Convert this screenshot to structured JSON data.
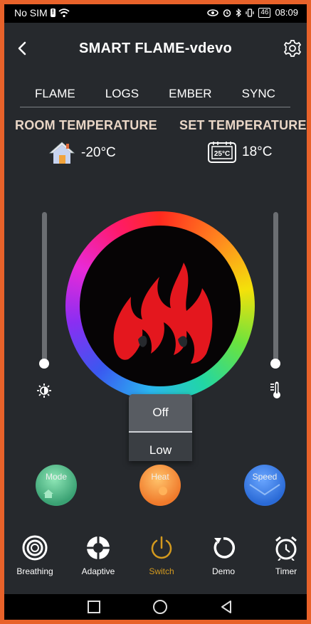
{
  "status_bar": {
    "carrier": "No SIM",
    "battery": "46",
    "time": "08:09"
  },
  "header": {
    "title": "SMART FLAME-vdevo",
    "back_icon": "back-chevron-icon",
    "settings_icon": "gear-icon"
  },
  "tabs": [
    {
      "label": "FLAME"
    },
    {
      "label": "LOGS"
    },
    {
      "label": "EMBER"
    },
    {
      "label": "SYNC"
    }
  ],
  "room_temperature": {
    "label": "ROOM TEMPERATURE",
    "value": "-20°C",
    "icon": "house-icon"
  },
  "set_temperature": {
    "label": "SET TEMPERATURE",
    "value": "18°C",
    "icon": "thermostat-display-icon",
    "icon_text": "25°C"
  },
  "brightness_slider": {
    "level": 0.0,
    "icon": "brightness-icon"
  },
  "temperature_slider": {
    "level": 0.0,
    "icon": "thermometer-icon"
  },
  "heat_dropdown": {
    "options": [
      "Off",
      "Low"
    ],
    "selected": "Off"
  },
  "mode_buttons": [
    {
      "label": "Mode",
      "icon": "home-icon",
      "color": "#3aa173"
    },
    {
      "label": "Heat",
      "icon": "flame-dot-icon",
      "color": "#f07a2b"
    },
    {
      "label": "Speed",
      "icon": "envelope-icon",
      "color": "#2a6ad6"
    }
  ],
  "toolbar": [
    {
      "label": "Breathing",
      "icon": "breathing-icon"
    },
    {
      "label": "Adaptive",
      "icon": "adaptive-icon"
    },
    {
      "label": "Switch",
      "icon": "power-icon",
      "active": true,
      "active_color": "#d49a1e"
    },
    {
      "label": "Demo",
      "icon": "refresh-icon"
    },
    {
      "label": "Timer",
      "icon": "alarm-clock-icon"
    }
  ],
  "flame_color": "#e4171e"
}
